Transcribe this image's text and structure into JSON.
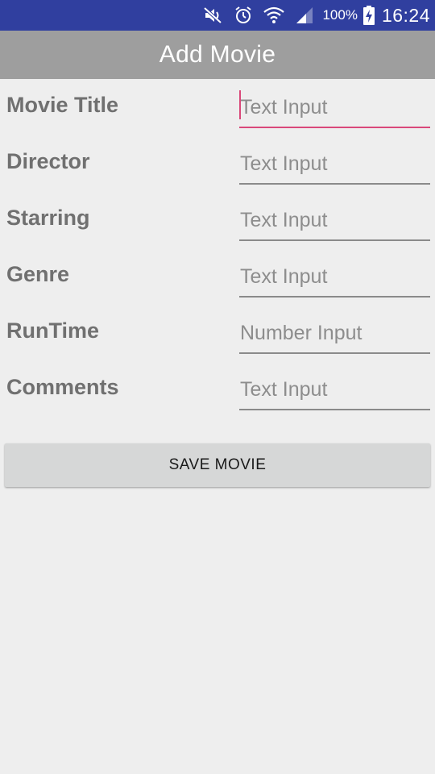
{
  "status_bar": {
    "icons": [
      "mute-icon",
      "alarm-icon",
      "wifi-icon",
      "signal-icon",
      "battery-charging-icon"
    ],
    "battery_percent": "100%",
    "time": "16:24",
    "background_color": "#303f9f"
  },
  "app_bar": {
    "title": "Add Movie",
    "background_color": "#9e9e9e"
  },
  "form": {
    "fields": [
      {
        "label": "Movie Title",
        "placeholder": "Text Input",
        "value": "",
        "focused": true
      },
      {
        "label": "Director",
        "placeholder": "Text Input",
        "value": ""
      },
      {
        "label": "Starring",
        "placeholder": "Text Input",
        "value": ""
      },
      {
        "label": "Genre",
        "placeholder": "Text Input",
        "value": ""
      },
      {
        "label": "RunTime",
        "placeholder": "Number Input",
        "value": ""
      },
      {
        "label": "Comments",
        "placeholder": "Text Input",
        "value": ""
      }
    ],
    "focus_color": "#d9487a"
  },
  "save_button": {
    "label": "SAVE MOVIE"
  }
}
